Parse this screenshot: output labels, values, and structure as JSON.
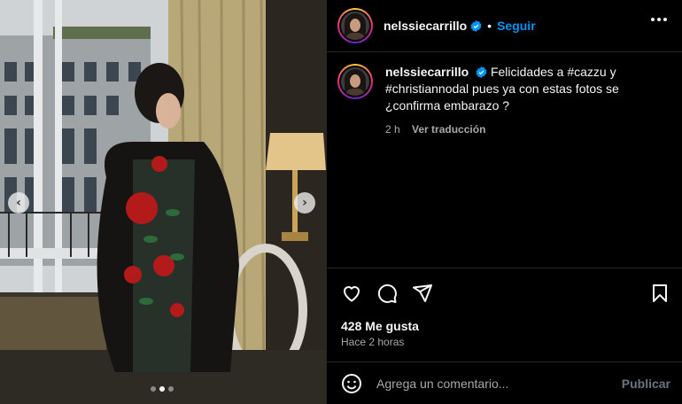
{
  "post": {
    "username": "nelssiecarrillo",
    "follow_label": "Seguir",
    "separator": "•",
    "caption_username": "nelssiecarrillo",
    "caption": "Felicidades a #cazzu y #christiannodal pues ya con estas fotos se ¿confirma embarazo ?",
    "caption_age": "2 h",
    "translate_label": "Ver traducción",
    "likes": "428 Me gusta",
    "posted_time": "Hace 2 horas",
    "comment_placeholder": "Agrega un comentario...",
    "publish_label": "Publicar"
  },
  "carousel": {
    "total": 3,
    "active": 2
  },
  "colors": {
    "accent": "#0095f6",
    "background": "#000000",
    "muted": "#a8a8a8"
  },
  "icons": [
    "heart-icon",
    "comment-icon",
    "share-icon",
    "bookmark-icon",
    "emoji-icon",
    "verified-icon",
    "more-icon",
    "chevron-left-icon",
    "chevron-right-icon"
  ]
}
